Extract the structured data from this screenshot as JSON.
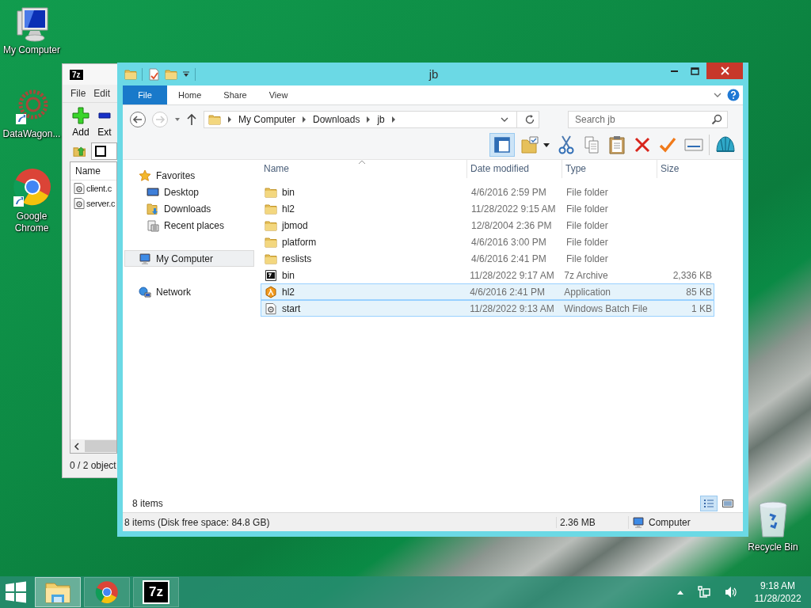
{
  "desktop_icons": [
    {
      "label": "My Computer",
      "kind": "computer"
    },
    {
      "label": "DataWagon...",
      "kind": "datawagon"
    },
    {
      "label": "Google Chrome",
      "kind": "chrome"
    },
    {
      "label": "Recycle Bin",
      "kind": "recycle"
    }
  ],
  "archive_window": {
    "icon_text": "7z",
    "menu": [
      "File",
      "Edit"
    ],
    "toolbar": [
      {
        "label": "Add",
        "kind": "add"
      },
      {
        "label": "Ext",
        "kind": "extract"
      }
    ],
    "column": "Name",
    "files": [
      "client.c",
      "server.c"
    ],
    "status": "0 / 2 object"
  },
  "explorer": {
    "title": "jb",
    "ribbon_tabs": [
      {
        "label": "File",
        "selected": true
      },
      {
        "label": "Home",
        "selected": false
      },
      {
        "label": "Share",
        "selected": false
      },
      {
        "label": "View",
        "selected": false
      }
    ],
    "breadcrumb": [
      "My Computer",
      "Downloads",
      "jb"
    ],
    "search": {
      "placeholder": "Search jb"
    },
    "nav": [
      {
        "label": "Favorites",
        "kind": "favorites",
        "selected": false,
        "children": [
          {
            "label": "Desktop",
            "kind": "desktop",
            "selected": false
          },
          {
            "label": "Downloads",
            "kind": "downloads",
            "selected": false
          },
          {
            "label": "Recent places",
            "kind": "recent",
            "selected": false
          }
        ]
      },
      {
        "label": "My Computer",
        "kind": "computer",
        "selected": true
      },
      {
        "label": "Network",
        "kind": "network",
        "selected": false
      }
    ],
    "columns": [
      "Name",
      "Date modified",
      "Type",
      "Size"
    ],
    "rows": [
      {
        "name": "bin",
        "date": "4/6/2016 2:59 PM",
        "type": "File folder",
        "kind": "folder",
        "selected": false
      },
      {
        "name": "hl2",
        "date": "11/28/2022 9:15 AM",
        "type": "File folder",
        "kind": "folder",
        "selected": false
      },
      {
        "name": "jbmod",
        "date": "12/8/2004 2:36 PM",
        "type": "File folder",
        "kind": "folder",
        "selected": false
      },
      {
        "name": "platform",
        "date": "4/6/2016 3:00 PM",
        "type": "File folder",
        "kind": "folder",
        "selected": false
      },
      {
        "name": "reslists",
        "date": "4/6/2016 2:41 PM",
        "type": "File folder",
        "kind": "folder",
        "selected": false
      },
      {
        "name": "bin",
        "date": "11/28/2022 9:17 AM",
        "type": "7z Archive",
        "size": "2,336 KB",
        "kind": "archive",
        "selected": false
      },
      {
        "name": "hl2",
        "date": "4/6/2016 2:41 PM",
        "type": "Application",
        "size": "85 KB",
        "kind": "app",
        "selected": true
      },
      {
        "name": "start",
        "date": "11/28/2022 9:13 AM",
        "type": "Windows Batch File",
        "size": "1 KB",
        "kind": "batch",
        "selected": true
      }
    ],
    "item_count": "8 items",
    "view_buttons": [
      {
        "kind": "details",
        "selected": true
      },
      {
        "kind": "thumbnails",
        "selected": false
      }
    ],
    "status": {
      "summary": "8 items (Disk free space: 84.8 GB)",
      "size": "2.36 MB",
      "location": "Computer"
    }
  },
  "taskbar": {
    "apps": [
      {
        "kind": "explorer",
        "selected": true
      },
      {
        "kind": "chrome",
        "selected": false
      },
      {
        "kind": "sevenzip",
        "selected": false,
        "icon_text": "7z"
      }
    ],
    "time": "9:18 AM",
    "date": "11/28/2022"
  }
}
